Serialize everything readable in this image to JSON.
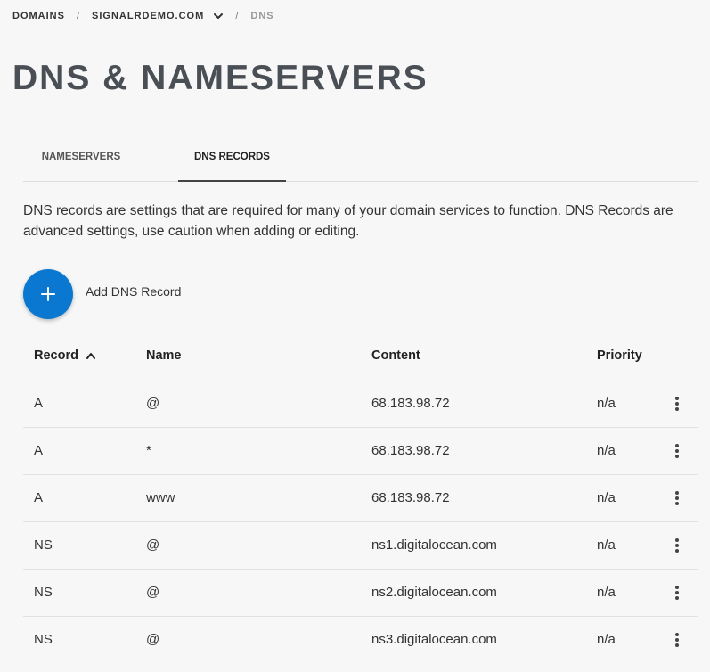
{
  "breadcrumb": {
    "root": "DOMAINS",
    "domain": "SIGNALRDEMO.COM",
    "current": "DNS",
    "separator": "/"
  },
  "page_title": "DNS & NAMESERVERS",
  "tabs": [
    {
      "label": "NAMESERVERS",
      "active": false
    },
    {
      "label": "DNS RECORDS",
      "active": true
    }
  ],
  "intro": "DNS records are settings that are required for many of your domain services to function. DNS Records are advanced settings, use caution when adding or editing.",
  "add_button": {
    "icon": "plus-icon",
    "label": "Add DNS Record"
  },
  "table": {
    "headers": {
      "record": "Record",
      "name": "Name",
      "content": "Content",
      "priority": "Priority"
    },
    "sort": {
      "column": "record",
      "direction": "ascending"
    },
    "rows": [
      {
        "record": "A",
        "name": "@",
        "content": "68.183.98.72",
        "priority": "n/a"
      },
      {
        "record": "A",
        "name": "*",
        "content": "68.183.98.72",
        "priority": "n/a"
      },
      {
        "record": "A",
        "name": "www",
        "content": "68.183.98.72",
        "priority": "n/a"
      },
      {
        "record": "NS",
        "name": "@",
        "content": "ns1.digitalocean.com",
        "priority": "n/a"
      },
      {
        "record": "NS",
        "name": "@",
        "content": "ns2.digitalocean.com",
        "priority": "n/a"
      },
      {
        "record": "NS",
        "name": "@",
        "content": "ns3.digitalocean.com",
        "priority": "n/a"
      }
    ]
  },
  "colors": {
    "accent": "#0a78d1",
    "title": "#4a4f56",
    "background": "#f7f7f7"
  }
}
